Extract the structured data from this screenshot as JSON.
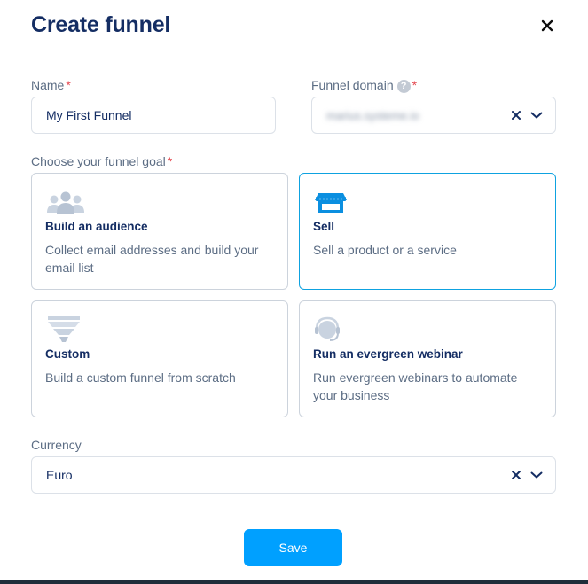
{
  "modal": {
    "title": "Create funnel"
  },
  "form": {
    "name": {
      "label": "Name",
      "required_mark": "*",
      "value": "My First Funnel"
    },
    "domain": {
      "label": "Funnel domain",
      "help": "?",
      "required_mark": "*",
      "value": "marius.systeme.io"
    },
    "goal": {
      "label": "Choose your funnel goal",
      "required_mark": "*",
      "selected": "Sell",
      "options": [
        {
          "title": "Build an audience",
          "description": "Collect email addresses and build your email list",
          "icon": "audience-icon"
        },
        {
          "title": "Sell",
          "description": "Sell a product or a service",
          "icon": "store-icon"
        },
        {
          "title": "Custom",
          "description": "Build a custom funnel from scratch",
          "icon": "funnel-icon"
        },
        {
          "title": "Run an evergreen webinar",
          "description": "Run evergreen webinars to automate your business",
          "icon": "headset-icon"
        }
      ]
    },
    "currency": {
      "label": "Currency",
      "value": "Euro"
    }
  },
  "actions": {
    "save_label": "Save"
  },
  "colors": {
    "primary": "#00a0ff",
    "selected_border": "#0ea2e0",
    "heading": "#142d63",
    "required": "#e4474f"
  }
}
